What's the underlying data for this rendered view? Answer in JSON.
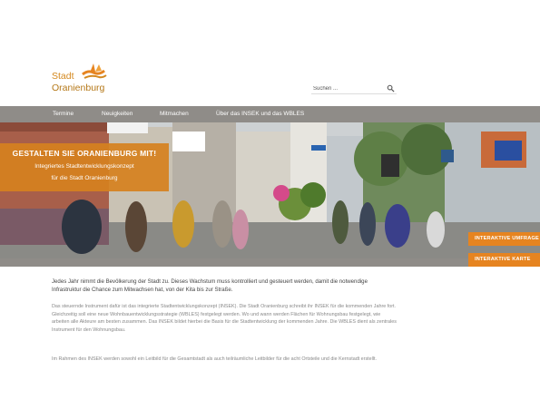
{
  "logo": {
    "line1": "Stadt",
    "line2": "Oranienburg",
    "icon": "ship-wave-logo-icon"
  },
  "search": {
    "placeholder": "Suchen ...",
    "icon": "search-icon"
  },
  "nav": {
    "items": [
      "Termine",
      "Neuigkeiten",
      "Mitmachen",
      "Über das INSEK und das WBLES"
    ]
  },
  "hero": {
    "title": "GESTALTEN SIE ORANIENBURG MIT!",
    "subtitle_line1": "Integriertes Stadtentwicklungskonzept",
    "subtitle_line2": "für die Stadt Oranienburg"
  },
  "side_buttons": {
    "survey": "INTERAKTIVE UMFRAGE",
    "map": "INTERAKTIVE KARTE"
  },
  "content": {
    "lead": "Jedes Jahr nimmt die Bevölkerung der Stadt zu. Dieses Wachstum muss kontrolliert und gesteuert werden, damit die notwendige Infrastruktur die Chance zum Mitwachsen hat, von der Kita bis zur Straße.",
    "p1": "Das steuernde Instrument dafür ist das integrierte Stadtentwicklungskonzept (INSEK). Die Stadt Oranienburg schreibt ihr INSEK für die kommenden Jahre fort. Gleichzeitig soll eine neue Wohnbauentwicklungsstrategie (WBLES) festgelegt werden. Wo und wann werden Flächen für Wohnungsbau festgelegt, wie arbeiten alle Akteure am besten zusammen. Das INSEK bildet hierbei die Basis für die Stadtentwicklung der kommenden Jahre. Die WBLES dient als zentrales Instrument für den Wohnungsbau.",
    "p2": "Im Rahmen des INSEK werden sowohl ein Leitbild für die Gesamtstadt als auch teilräumliche Leitbilder für die acht Ortsteile und die Kernstadt erstellt."
  },
  "colors": {
    "accent": "#e68420",
    "nav_bg": "#8f8c88",
    "logo": "#d4881e"
  }
}
